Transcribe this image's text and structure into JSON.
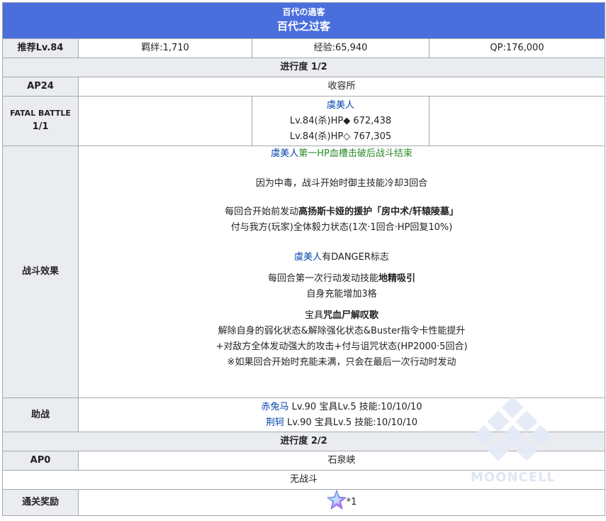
{
  "header": {
    "title_jp": "百代の過客",
    "title_cn": "百代之过客"
  },
  "summary": {
    "recommend_level": "推荐Lv.84",
    "bond": "羁绊:1,710",
    "exp": "经验:65,940",
    "qp": "QP:176,000"
  },
  "progress1": {
    "label": "进行度 1/2",
    "ap": "AP24",
    "location": "收容所",
    "battle_label_line1": "FATAL BATTLE",
    "battle_label_line2": "1/1",
    "enemy_name": "虞美人",
    "enemy_line1": "Lv.84(杀)HP◆ 672,438",
    "enemy_line2": "Lv.84(杀)HP◇ 767,305"
  },
  "effects": {
    "label": "战斗效果",
    "l1_name": "虞美人",
    "l1_rest": "第一HP血槽击破后战斗结束",
    "l2": "因为中毒，战斗开始时御主技能冷却3回合",
    "l3_pre": "每回合开始前发动",
    "l3_bold": "高扬斯卡娅的援护「房中术/轩辕陵墓」",
    "l4": "付与我方(玩家)全体毅力状态(1次·1回合·HP回复10%)",
    "l5_name": "虞美人",
    "l5_rest": "有DANGER标志",
    "l6_pre": "每回合第一次行动发动技能",
    "l6_bold": "地精吸引",
    "l7": "自身充能增加3格",
    "l8_pre": "宝具",
    "l8_bold": "咒血尸解叹歌",
    "l9": "解除自身的弱化状态&解除强化状态&Buster指令卡性能提升",
    "l10": "+对敌方全体发动强大的攻击+付与诅咒状态(HP2000·5回合)",
    "l11": "※如果回合开始时充能未满，只会在最后一次行动时发动"
  },
  "support": {
    "label": "助战",
    "s1_name": "赤兔马",
    "s1_rest": " Lv.90 宝具Lv.5 技能:10/10/10",
    "s2_name": "荆轲",
    "s2_rest": " Lv.90 宝具Lv.5 技能:10/10/10"
  },
  "progress2": {
    "label": "进行度 2/2",
    "ap": "AP0",
    "location": "石泉峡",
    "no_battle": "无战斗"
  },
  "reward": {
    "label": "通关奖励",
    "count": "*1",
    "icon": "saint-quartz-icon"
  },
  "watermark": "MOONCELL",
  "colors": {
    "header": "#4a6fdd",
    "label_bg": "#eaecf0",
    "link": "#0645ad",
    "green": "#2a8a2a"
  }
}
